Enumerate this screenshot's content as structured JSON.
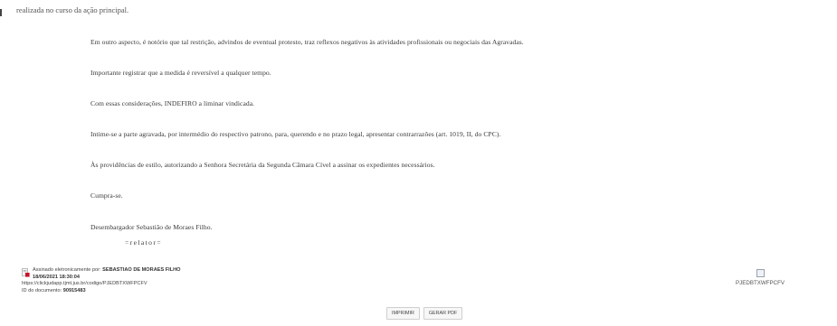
{
  "document": {
    "top_fragment": "realizada no curso da ação principal.",
    "paragraphs": [
      "Em outro aspecto, é notório que tal restrição, advindos de eventual protesto, traz reflexos negativos às atividades profissionais ou negociais das Agravadas.",
      "Importante registrar que a medida é reversível a qualquer tempo.",
      "Com essas considerações, INDEFIRO a liminar vindicada.",
      "Intime-se a parte agravada, por intermédio do respectivo patrono, para, querendo e no prazo legal, apresentar contrarrazões (art. 1019, II, do CPC).",
      "Às providências de estilo, autorizando a Senhora Secretária da Segunda Câmara Cível a assinar os expedientes necessários.",
      "Cumpra-se.",
      "Desembargador Sebastião de Moraes Filho."
    ],
    "relator": "=relator="
  },
  "signature": {
    "signed_label": "Assinado eletronicamente por:",
    "signer": "SEBASTIAO DE MORAES FILHO",
    "datetime": "18/06/2021 18:30:04",
    "url": "https://clickjudapp.tjmt.jus.br/codigo/PJEDBTXWFPCFV",
    "doc_id_label": "ID do documento:",
    "doc_id": "90915483",
    "icon": "signed-pdf-icon"
  },
  "qr": {
    "code_text": "PJEDBTXWFPCFV",
    "icon": "broken-image-icon"
  },
  "buttons": {
    "print": "IMPRIMIR",
    "pdf": "GERAR PDF"
  }
}
